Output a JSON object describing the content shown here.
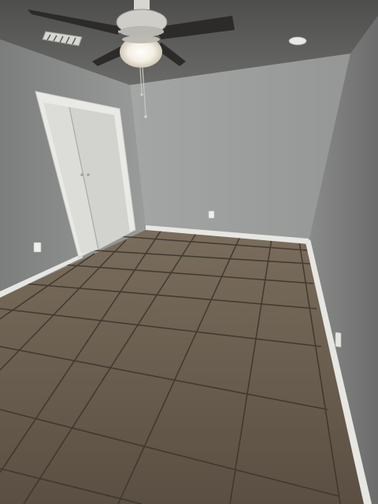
{
  "scene": {
    "kind": "empty-bedroom-photo",
    "objects": [
      "ceiling",
      "ceiling-fan",
      "fan-light",
      "pull-chain",
      "air-vent",
      "smoke-detector",
      "left-wall",
      "back-wall",
      "right-wall",
      "closet-door",
      "baseboard",
      "electrical-outlet",
      "tile-floor"
    ]
  },
  "colors": {
    "ceiling": "#5c5c5a",
    "wall_left": "#8a8c8b",
    "wall_back": "#9a9c9b",
    "wall_right": "#7f807f",
    "door": "#dcdcd8",
    "trim": "#e6e6e2",
    "floor": "#6a5e4f",
    "grout": "#3b342c",
    "fan_blade": "#2d2b29",
    "light_glass": "#f4f0e6"
  }
}
